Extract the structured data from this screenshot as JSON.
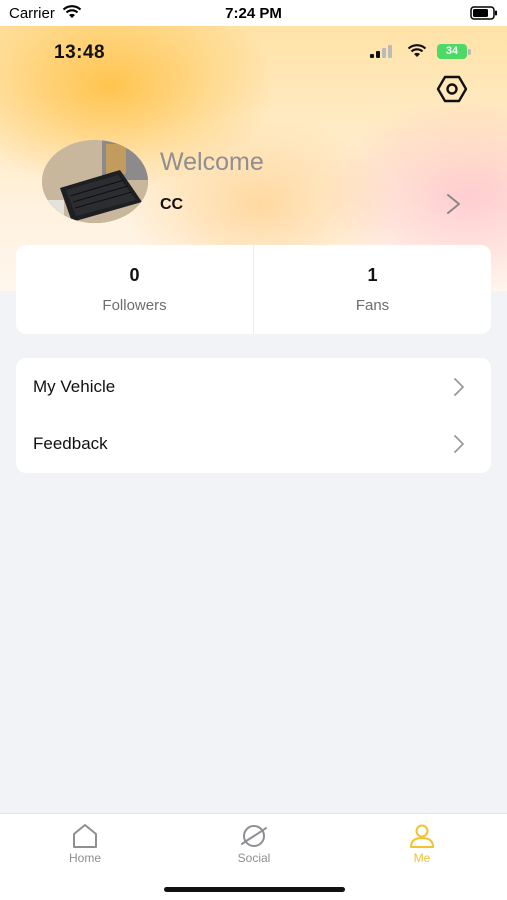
{
  "system_status": {
    "carrier": "Carrier",
    "time": "7:24 PM"
  },
  "app_status": {
    "time": "13:48",
    "battery": "34"
  },
  "profile": {
    "welcome": "Welcome",
    "username": "CC"
  },
  "stats": [
    {
      "value": "0",
      "label": "Followers"
    },
    {
      "value": "1",
      "label": "Fans"
    }
  ],
  "menu": [
    {
      "label": "My Vehicle"
    },
    {
      "label": "Feedback"
    }
  ],
  "tabs": [
    {
      "label": "Home",
      "icon": "home-icon"
    },
    {
      "label": "Social",
      "icon": "planet-icon"
    },
    {
      "label": "Me",
      "icon": "person-icon",
      "active": true
    }
  ],
  "colors": {
    "accent": "#f2c230",
    "battery_green": "#4cd964",
    "background": "#f2f3f6"
  }
}
